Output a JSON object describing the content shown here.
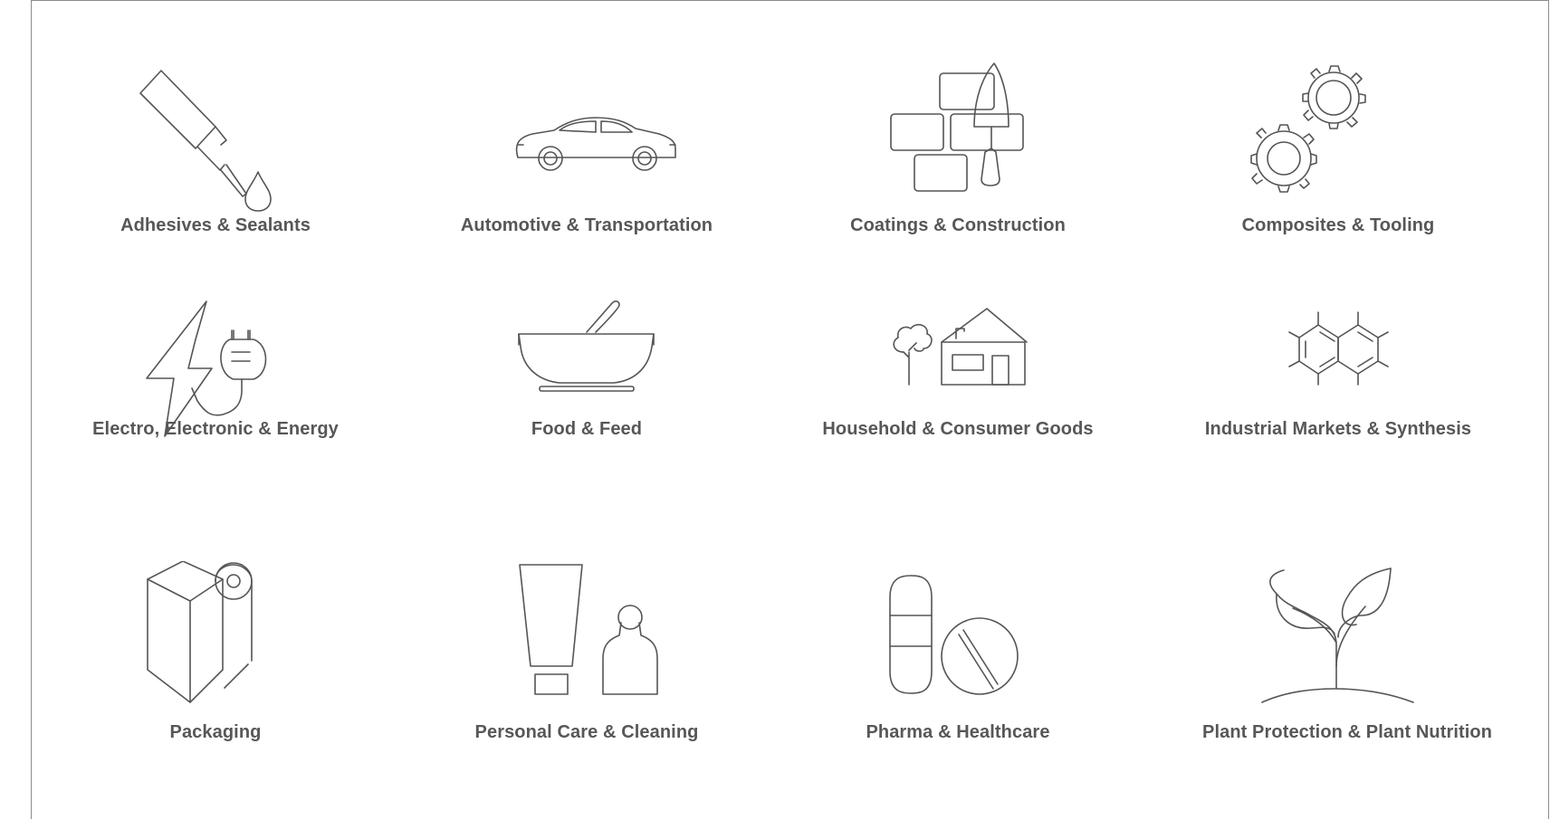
{
  "colors": {
    "text": "#575757",
    "icon_stroke": "#555555",
    "frame": "#8c8c8c",
    "background": "#ffffff"
  },
  "industries": [
    {
      "label": "Adhesives & Sealants",
      "icon": "glue-bottle-icon"
    },
    {
      "label": "Automotive & Transportation",
      "icon": "car-icon"
    },
    {
      "label": "Coatings & Construction",
      "icon": "bricks-trowel-icon"
    },
    {
      "label": "Composites & Tooling",
      "icon": "gears-icon"
    },
    {
      "label": "Electro, Electronic & Energy",
      "icon": "lightning-plug-icon"
    },
    {
      "label": "Food & Feed",
      "icon": "mortar-pestle-icon"
    },
    {
      "label": "Household & Consumer Goods",
      "icon": "house-tree-icon"
    },
    {
      "label": "Industrial Markets & Synthesis",
      "icon": "molecule-icon"
    },
    {
      "label": "Packaging",
      "icon": "box-roll-icon"
    },
    {
      "label": "Personal Care & Cleaning",
      "icon": "tube-bottle-icon"
    },
    {
      "label": "Pharma & Healthcare",
      "icon": "capsule-pill-icon"
    },
    {
      "label": "Plant Protection & Plant Nutrition",
      "icon": "seedling-icon"
    }
  ]
}
